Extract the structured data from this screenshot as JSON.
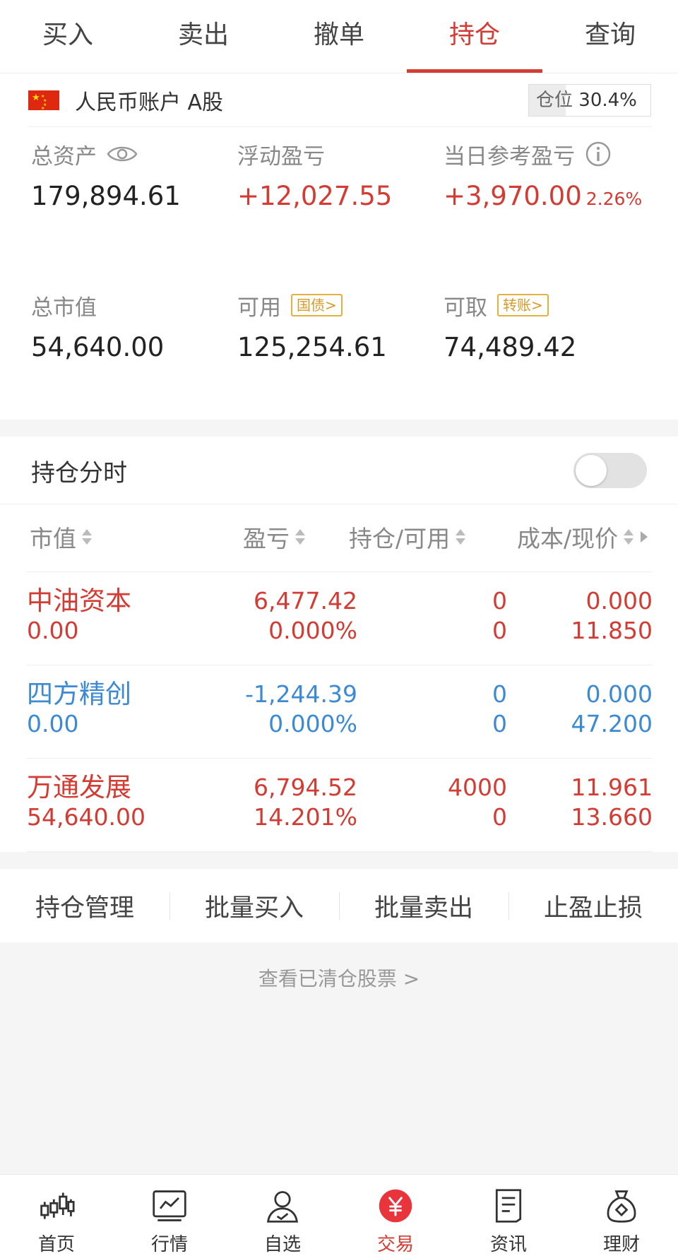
{
  "tabs": [
    {
      "label": "买入",
      "active": false
    },
    {
      "label": "卖出",
      "active": false
    },
    {
      "label": "撤单",
      "active": false
    },
    {
      "label": "持仓",
      "active": true
    },
    {
      "label": "查询",
      "active": false
    }
  ],
  "account": {
    "name": "人民币账户 A股",
    "position_label": "仓位",
    "position_value": "30.4%",
    "position_fraction": 0.304
  },
  "stats": {
    "total_assets": {
      "label": "总资产",
      "value": "179,894.61"
    },
    "floating_pl": {
      "label": "浮动盈亏",
      "value": "+12,027.55"
    },
    "daily_pl": {
      "label": "当日参考盈亏",
      "value": "+3,970.00",
      "pct": "2.26%"
    },
    "market_value": {
      "label": "总市值",
      "value": "54,640.00"
    },
    "available": {
      "label": "可用",
      "value": "125,254.61",
      "tag": "国债>"
    },
    "withdrawable": {
      "label": "可取",
      "value": "74,489.42",
      "tag": "转账>"
    }
  },
  "timeshare": {
    "title": "持仓分时",
    "enabled": false
  },
  "table": {
    "headers": [
      "市值",
      "盈亏",
      "持仓/可用",
      "成本/现价"
    ],
    "rows": [
      {
        "name": "中油资本",
        "market_value": "0.00",
        "pl": "6,477.42",
        "pl_pct": "0.000%",
        "hold": "0",
        "avail": "0",
        "cost": "0.000",
        "price": "11.850",
        "color": "red"
      },
      {
        "name": "四方精创",
        "market_value": "0.00",
        "pl": "-1,244.39",
        "pl_pct": "0.000%",
        "hold": "0",
        "avail": "0",
        "cost": "0.000",
        "price": "47.200",
        "color": "blue"
      },
      {
        "name": "万通发展",
        "market_value": "54,640.00",
        "pl": "6,794.52",
        "pl_pct": "14.201%",
        "hold": "4000",
        "avail": "0",
        "cost": "11.961",
        "price": "13.660",
        "color": "red"
      }
    ]
  },
  "actions": [
    "持仓管理",
    "批量买入",
    "批量卖出",
    "止盈止损"
  ],
  "cleared_link": "查看已清仓股票 >",
  "bottom_nav": [
    {
      "label": "首页",
      "icon": "candlestick-icon",
      "active": false
    },
    {
      "label": "行情",
      "icon": "chart-icon",
      "active": false
    },
    {
      "label": "自选",
      "icon": "person-icon",
      "active": false
    },
    {
      "label": "交易",
      "icon": "yuan-icon",
      "active": true
    },
    {
      "label": "资讯",
      "icon": "news-icon",
      "active": false
    },
    {
      "label": "理财",
      "icon": "moneybag-icon",
      "active": false
    }
  ],
  "colors": {
    "red": "#d33b33",
    "blue": "#3c8ad4",
    "gold": "#e4b13f"
  }
}
